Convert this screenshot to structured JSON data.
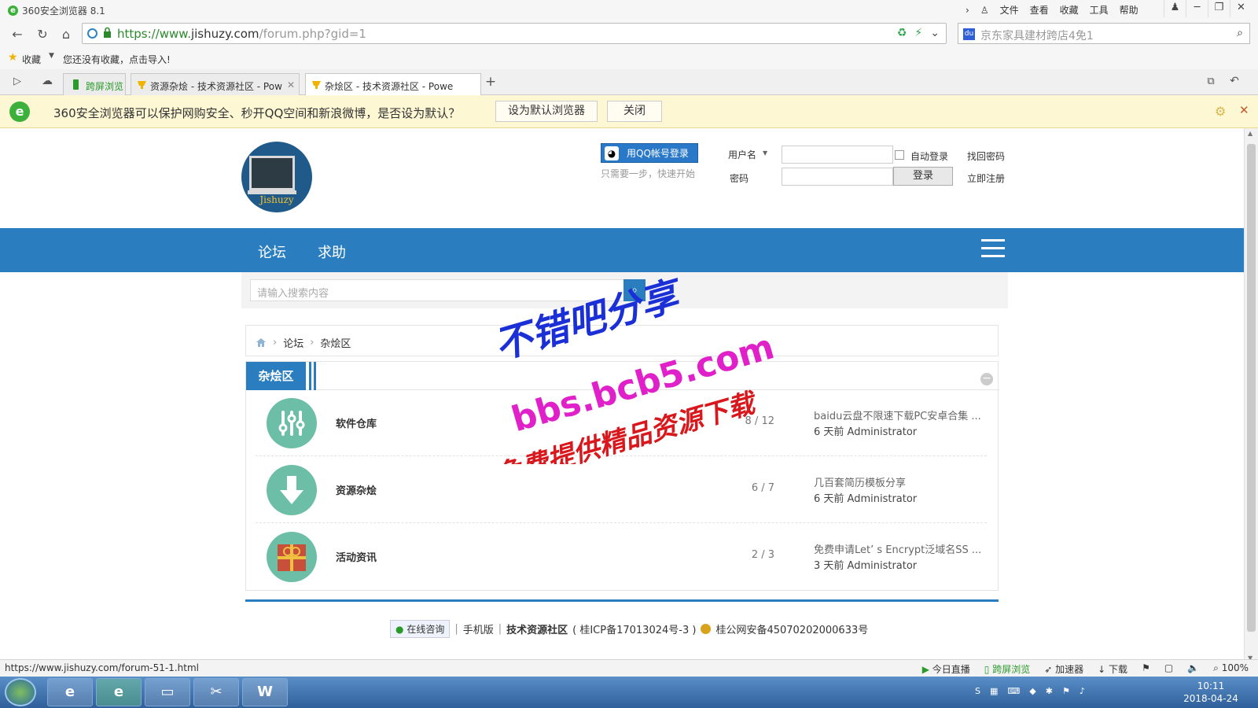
{
  "browser": {
    "title": "360安全浏览器 8.1",
    "menus": [
      "文件",
      "查看",
      "收藏",
      "工具",
      "帮助"
    ],
    "url_prefix": "https://www.",
    "url_domain": "jishuzy.com",
    "url_path": "/forum.php?gid=1",
    "search_text": "京东家具建材跨店4免1",
    "fav_label": "收藏",
    "fav_import": "您还没有收藏，点击导入!",
    "tabs": [
      {
        "label": "跨屏浏览",
        "active": false
      },
      {
        "label": "资源杂烩 - 技术资源社区 - Pow",
        "active": false
      },
      {
        "label": "杂烩区 - 技术资源社区 - Powe",
        "active": true
      }
    ],
    "notify_text": "360安全浏览器可以保护网购安全、秒开QQ空间和新浪微博，是否设为默认？",
    "notify_set_default": "设为默认浏览器",
    "notify_close": "关闭",
    "status_url": "https://www.jishuzy.com/forum-51-1.html",
    "status_items": [
      "今日直播",
      "跨屏浏览",
      "加速器",
      "下载",
      "100%"
    ]
  },
  "site": {
    "logo_text": "Jishuzy",
    "qq_login": "用QQ帐号登录",
    "qq_tip": "只需要一步，快速开始",
    "username_label": "用户名",
    "password_label": "密码",
    "auto_login": "自动登录",
    "find_password": "找回密码",
    "login_button": "登录",
    "register": "立即注册",
    "nav": [
      "论坛",
      "求助"
    ],
    "search_placeholder": "请输入搜索内容",
    "breadcrumb": [
      "论坛",
      "杂烩区"
    ],
    "section_title": "杂烩区",
    "forums": [
      {
        "name": "软件仓库",
        "count": "8 / 12",
        "last_title": "baidu云盘不限速下载PC安卓合集 ...",
        "last_meta": "6 天前 Administrator",
        "icon": "sliders-icon"
      },
      {
        "name": "资源杂烩",
        "count": "6 / 7",
        "last_title": "几百套简历模板分享",
        "last_meta": "6 天前 Administrator",
        "icon": "download-arrow-icon"
      },
      {
        "name": "活动资讯",
        "count": "2 / 3",
        "last_title": "免费申请Let’ s Encrypt泛域名SS ...",
        "last_meta": "3 天前 Administrator",
        "icon": "gift-icon"
      }
    ],
    "footer": {
      "consult": "在线咨询",
      "mobile": "手机版",
      "site_name": "技术资源社区",
      "icp": "( 桂ICP备17013024号-3 )",
      "police": "桂公网安备45070202000633号"
    }
  },
  "watermark": {
    "line1": "不错吧分享",
    "line2": "bbs.bcb5.com",
    "line3": "免费提供精品资源下载"
  },
  "taskbar": {
    "time": "10:11",
    "date": "2018-04-24"
  },
  "colors": {
    "accent": "#2a7ebf",
    "forum_icon": "#6cbfa6",
    "notify_bg": "#fdf7d4",
    "watermark_blue": "#1a2fd6",
    "watermark_pink": "#e020c8",
    "watermark_red": "#d8181c"
  }
}
